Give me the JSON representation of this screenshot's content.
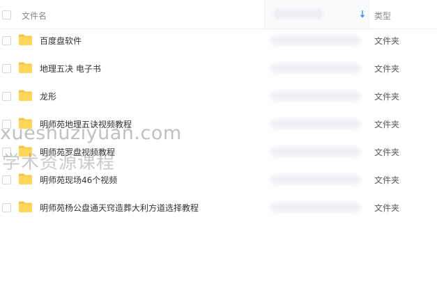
{
  "header": {
    "name_label": "文件名",
    "type_label": "类型"
  },
  "files": [
    {
      "name": "百度盘软件",
      "type": "文件夹"
    },
    {
      "name": "地理五决 电子书",
      "type": "文件夹"
    },
    {
      "name": "龙形",
      "type": "文件夹"
    },
    {
      "name": "明师苑地理五诀视频教程",
      "type": "文件夹"
    },
    {
      "name": "明师苑罗盘视频教程",
      "type": "文件夹"
    },
    {
      "name": "明师苑现场46个视频",
      "type": "文件夹"
    },
    {
      "name": "明师苑杨公盘通天窍造葬大利方道选择教程",
      "type": "文件夹"
    }
  ],
  "watermark": {
    "line1": "xueshuziyuan.com",
    "line2": "学术资源课程"
  },
  "colors": {
    "folder": "#ffd65a",
    "folder_tab": "#f7c744",
    "sort_arrow": "#3b8cff"
  },
  "icons": {
    "folder": "folder-icon",
    "sort": "sort-arrow-icon"
  }
}
